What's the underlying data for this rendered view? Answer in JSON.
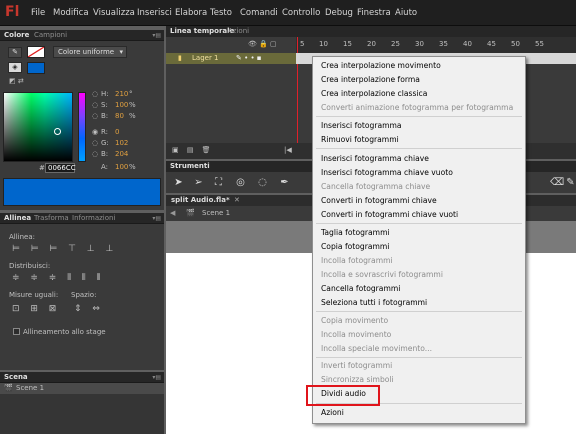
{
  "app": {
    "logo": "Fl"
  },
  "menubar": [
    "File",
    "Modifica",
    "Visualizza",
    "Inserisci",
    "Elabora",
    "Testo",
    "Comandi",
    "Controllo",
    "Debug",
    "Finestra",
    "Aiuto"
  ],
  "color_panel": {
    "tabs": [
      "Colore",
      "Campioni"
    ],
    "fill_type": "Colore uniforme",
    "labels": {
      "h": "H:",
      "s": "S:",
      "b": "B:",
      "r": "R:",
      "g": "G:",
      "b2": "B:",
      "a": "A:"
    },
    "values": {
      "h": "210",
      "s": "100",
      "b": "80",
      "r": "0",
      "g": "102",
      "b2": "204",
      "a": "100"
    },
    "units": {
      "h": "°",
      "s": "%",
      "b": "%",
      "a": "%"
    },
    "hash": "#",
    "hex": "0066CC",
    "selected_color": "#0066cc"
  },
  "align_panel": {
    "tabs": [
      "Allinea",
      "Trasforma",
      "Informazioni"
    ],
    "align_label": "Allinea:",
    "distribute_label": "Distribuisci:",
    "match_label": "Misure uguali:",
    "space_label": "Spazio:",
    "to_stage": "Allineamento allo stage"
  },
  "scene_panel": {
    "tab": "Scena",
    "item": "Scene 1"
  },
  "timeline": {
    "tabs": [
      "Linea temporale",
      "Azioni"
    ],
    "layer": "Lager 1",
    "frame_numbers": [
      "5",
      "10",
      "15",
      "20",
      "25",
      "30",
      "35",
      "40",
      "45",
      "50",
      "55"
    ]
  },
  "tools": {
    "title": "Strumenti"
  },
  "document": {
    "tab": "split Audio.fla*",
    "scene": "Scene 1"
  },
  "context_menu": {
    "items": [
      {
        "label": "Crea interpolazione movimento",
        "disabled": false
      },
      {
        "label": "Crea interpolazione forma",
        "disabled": false
      },
      {
        "label": "Crea interpolazione classica",
        "disabled": false
      },
      {
        "label": "Converti animazione fotogramma per fotogramma",
        "disabled": true
      },
      {
        "label": "Inserisci fotogramma",
        "disabled": false
      },
      {
        "label": "Rimuovi fotogrammi",
        "disabled": false
      },
      {
        "label": "Inserisci fotogramma chiave",
        "disabled": false
      },
      {
        "label": "Inserisci fotogramma chiave vuoto",
        "disabled": false
      },
      {
        "label": "Cancella fotogramma chiave",
        "disabled": true
      },
      {
        "label": "Converti in fotogrammi chiave",
        "disabled": false
      },
      {
        "label": "Converti in fotogrammi chiave vuoti",
        "disabled": false
      },
      {
        "label": "Taglia fotogrammi",
        "disabled": false
      },
      {
        "label": "Copia fotogrammi",
        "disabled": false
      },
      {
        "label": "Incolla fotogrammi",
        "disabled": true
      },
      {
        "label": "Incolla e sovrascrivi fotogrammi",
        "disabled": true
      },
      {
        "label": "Cancella fotogrammi",
        "disabled": false
      },
      {
        "label": "Seleziona tutti i fotogrammi",
        "disabled": false
      },
      {
        "label": "Copia movimento",
        "disabled": true
      },
      {
        "label": "Incolla movimento",
        "disabled": true
      },
      {
        "label": "Incolla speciale movimento...",
        "disabled": true
      },
      {
        "label": "Inverti fotogrammi",
        "disabled": true
      },
      {
        "label": "Sincronizza simboli",
        "disabled": true
      },
      {
        "label": "Dividi audio",
        "disabled": false
      },
      {
        "label": "Azioni",
        "disabled": false
      }
    ]
  }
}
